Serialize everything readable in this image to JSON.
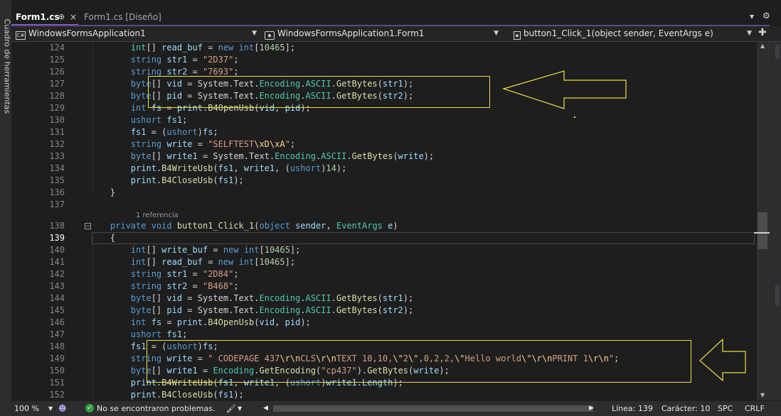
{
  "toolbox_label": "Cuadro de herramientas",
  "tabs": [
    {
      "label": "Form1.cs",
      "pin": "⊕",
      "close": "×"
    },
    {
      "label": "Form1.cs [Diseño]"
    }
  ],
  "top_icons": {
    "dropdown": "▾",
    "settings": "⚙"
  },
  "nav": {
    "project": "WindowsFormsApplication1",
    "class": "WindowsFormsApplication1.Form1",
    "member": "button1_Click_1(object sender, EventArgs e)"
  },
  "codelens_hint": "1 referencia",
  "lines": [
    {
      "n": "124",
      "tokens": [
        [
          "t",
          "        int"
        ],
        [
          "p",
          "[] "
        ],
        [
          "v",
          "read_buf"
        ],
        [
          "p",
          " = "
        ],
        [
          "k",
          "new"
        ],
        [
          "p",
          " "
        ],
        [
          "k",
          "int"
        ],
        [
          "p",
          "["
        ],
        [
          "n",
          "10465"
        ],
        [
          "p",
          "];"
        ]
      ]
    },
    {
      "n": "125",
      "tokens": [
        [
          "k",
          "        string"
        ],
        [
          "p",
          " "
        ],
        [
          "v",
          "str1"
        ],
        [
          "p",
          " = "
        ],
        [
          "s",
          "\"2D37\""
        ],
        [
          "p",
          ";"
        ]
      ]
    },
    {
      "n": "126",
      "tokens": [
        [
          "k",
          "        string"
        ],
        [
          "p",
          " "
        ],
        [
          "v",
          "str2"
        ],
        [
          "p",
          " = "
        ],
        [
          "s",
          "\"7693\""
        ],
        [
          "p",
          ";"
        ]
      ]
    },
    {
      "n": "127",
      "tokens": [
        [
          "k",
          "        byte"
        ],
        [
          "p",
          "[] "
        ],
        [
          "v",
          "vid"
        ],
        [
          "p",
          " = System.Text."
        ],
        [
          "t",
          "Encoding"
        ],
        [
          "p",
          "."
        ],
        [
          "t",
          "ASCII"
        ],
        [
          "p",
          "."
        ],
        [
          "m",
          "GetBytes"
        ],
        [
          "p",
          "("
        ],
        [
          "v",
          "str1"
        ],
        [
          "p",
          ");"
        ]
      ]
    },
    {
      "n": "128",
      "tokens": [
        [
          "k",
          "        byte"
        ],
        [
          "p",
          "[] "
        ],
        [
          "v",
          "pid"
        ],
        [
          "p",
          " = System.Text."
        ],
        [
          "t",
          "Encoding"
        ],
        [
          "p",
          "."
        ],
        [
          "t",
          "ASCII"
        ],
        [
          "p",
          "."
        ],
        [
          "m",
          "GetBytes"
        ],
        [
          "p",
          "("
        ],
        [
          "v",
          "str2"
        ],
        [
          "p",
          ");"
        ]
      ]
    },
    {
      "n": "129",
      "tokens": [
        [
          "k",
          "        int"
        ],
        [
          "p",
          " "
        ],
        [
          "v",
          "fs"
        ],
        [
          "p",
          " = "
        ],
        [
          "v",
          "print"
        ],
        [
          "p",
          "."
        ],
        [
          "m",
          "B4OpenUsb"
        ],
        [
          "p",
          "("
        ],
        [
          "v",
          "vid"
        ],
        [
          "p",
          ", "
        ],
        [
          "v",
          "pid"
        ],
        [
          "p",
          ");"
        ]
      ]
    },
    {
      "n": "130",
      "tokens": [
        [
          "k",
          "        ushort"
        ],
        [
          "p",
          " "
        ],
        [
          "v",
          "fs1"
        ],
        [
          "p",
          ";"
        ]
      ]
    },
    {
      "n": "131",
      "tokens": [
        [
          "v",
          "        fs1"
        ],
        [
          "p",
          " = ("
        ],
        [
          "k",
          "ushort"
        ],
        [
          "p",
          ")"
        ],
        [
          "v",
          "fs"
        ],
        [
          "p",
          ";"
        ]
      ]
    },
    {
      "n": "132",
      "tokens": [
        [
          "k",
          "        string"
        ],
        [
          "p",
          " "
        ],
        [
          "v",
          "write"
        ],
        [
          "p",
          " = "
        ],
        [
          "s",
          "\"SELFTEST"
        ],
        [
          "e",
          "\\xD\\xA"
        ],
        [
          "s",
          "\""
        ],
        [
          "p",
          ";"
        ]
      ]
    },
    {
      "n": "133",
      "tokens": [
        [
          "k",
          "        byte"
        ],
        [
          "p",
          "[] "
        ],
        [
          "v",
          "write1"
        ],
        [
          "p",
          " = System.Text."
        ],
        [
          "t",
          "Encoding"
        ],
        [
          "p",
          "."
        ],
        [
          "t",
          "ASCII"
        ],
        [
          "p",
          "."
        ],
        [
          "m",
          "GetBytes"
        ],
        [
          "p",
          "("
        ],
        [
          "v",
          "write"
        ],
        [
          "p",
          ");"
        ]
      ]
    },
    {
      "n": "134",
      "tokens": [
        [
          "v",
          "        print"
        ],
        [
          "p",
          "."
        ],
        [
          "m",
          "B4WriteUsb"
        ],
        [
          "p",
          "("
        ],
        [
          "v",
          "fs1"
        ],
        [
          "p",
          ", "
        ],
        [
          "v",
          "write1"
        ],
        [
          "p",
          ", ("
        ],
        [
          "k",
          "ushort"
        ],
        [
          "p",
          ")"
        ],
        [
          "n",
          "14"
        ],
        [
          "p",
          ");"
        ]
      ]
    },
    {
      "n": "135",
      "tokens": [
        [
          "v",
          "        print"
        ],
        [
          "p",
          "."
        ],
        [
          "m",
          "B4CloseUsb"
        ],
        [
          "p",
          "("
        ],
        [
          "v",
          "fs1"
        ],
        [
          "p",
          ");"
        ]
      ]
    },
    {
      "n": "136",
      "tokens": [
        [
          "p",
          "    }"
        ]
      ]
    },
    {
      "n": "137",
      "tokens": []
    },
    {
      "n": "138",
      "tokens": [
        [
          "k",
          "    private"
        ],
        [
          "p",
          " "
        ],
        [
          "k",
          "void"
        ],
        [
          "p",
          " "
        ],
        [
          "m",
          "button1_Click_1"
        ],
        [
          "p",
          "("
        ],
        [
          "k",
          "object"
        ],
        [
          "p",
          " "
        ],
        [
          "v",
          "sender"
        ],
        [
          "p",
          ", "
        ],
        [
          "t",
          "EventArgs"
        ],
        [
          "p",
          " "
        ],
        [
          "v",
          "e"
        ],
        [
          "p",
          ")"
        ]
      ]
    },
    {
      "n": "139",
      "tokens": [
        [
          "p",
          "    {"
        ]
      ]
    },
    {
      "n": "140",
      "tokens": [
        [
          "k",
          "        int"
        ],
        [
          "p",
          "[] "
        ],
        [
          "v",
          "write_buf"
        ],
        [
          "p",
          " = "
        ],
        [
          "k",
          "new"
        ],
        [
          "p",
          " "
        ],
        [
          "k",
          "int"
        ],
        [
          "p",
          "["
        ],
        [
          "n",
          "10465"
        ],
        [
          "p",
          "];"
        ]
      ]
    },
    {
      "n": "141",
      "tokens": [
        [
          "k",
          "        int"
        ],
        [
          "p",
          "[] "
        ],
        [
          "v",
          "read_buf"
        ],
        [
          "p",
          " = "
        ],
        [
          "k",
          "new"
        ],
        [
          "p",
          " "
        ],
        [
          "k",
          "int"
        ],
        [
          "p",
          "["
        ],
        [
          "n",
          "10465"
        ],
        [
          "p",
          "];"
        ]
      ]
    },
    {
      "n": "142",
      "tokens": [
        [
          "k",
          "        string"
        ],
        [
          "p",
          " "
        ],
        [
          "v",
          "str1"
        ],
        [
          "p",
          " = "
        ],
        [
          "s",
          "\"2D84\""
        ],
        [
          "p",
          ";"
        ]
      ]
    },
    {
      "n": "143",
      "tokens": [
        [
          "k",
          "        string"
        ],
        [
          "p",
          " "
        ],
        [
          "v",
          "str2"
        ],
        [
          "p",
          " = "
        ],
        [
          "s",
          "\"B468\""
        ],
        [
          "p",
          ";"
        ]
      ]
    },
    {
      "n": "144",
      "tokens": [
        [
          "k",
          "        byte"
        ],
        [
          "p",
          "[] "
        ],
        [
          "v",
          "vid"
        ],
        [
          "p",
          " = System.Text."
        ],
        [
          "t",
          "Encoding"
        ],
        [
          "p",
          "."
        ],
        [
          "t",
          "ASCII"
        ],
        [
          "p",
          "."
        ],
        [
          "m",
          "GetBytes"
        ],
        [
          "p",
          "("
        ],
        [
          "v",
          "str1"
        ],
        [
          "p",
          ");"
        ]
      ]
    },
    {
      "n": "145",
      "tokens": [
        [
          "k",
          "        byte"
        ],
        [
          "p",
          "[] "
        ],
        [
          "v",
          "pid"
        ],
        [
          "p",
          " = System.Text."
        ],
        [
          "t",
          "Encoding"
        ],
        [
          "p",
          "."
        ],
        [
          "t",
          "ASCII"
        ],
        [
          "p",
          "."
        ],
        [
          "m",
          "GetBytes"
        ],
        [
          "p",
          "("
        ],
        [
          "v",
          "str2"
        ],
        [
          "p",
          ");"
        ]
      ]
    },
    {
      "n": "146",
      "tokens": [
        [
          "k",
          "        int"
        ],
        [
          "p",
          " "
        ],
        [
          "v",
          "fs"
        ],
        [
          "p",
          " = "
        ],
        [
          "v",
          "print"
        ],
        [
          "p",
          "."
        ],
        [
          "m",
          "B4OpenUsb"
        ],
        [
          "p",
          "("
        ],
        [
          "v",
          "vid"
        ],
        [
          "p",
          ", "
        ],
        [
          "v",
          "pid"
        ],
        [
          "p",
          ");"
        ]
      ]
    },
    {
      "n": "147",
      "tokens": [
        [
          "k",
          "        ushort"
        ],
        [
          "p",
          " "
        ],
        [
          "v",
          "fs1"
        ],
        [
          "p",
          ";"
        ]
      ]
    },
    {
      "n": "148",
      "tokens": [
        [
          "v",
          "        fs1"
        ],
        [
          "p",
          " = ("
        ],
        [
          "k",
          "ushort"
        ],
        [
          "p",
          ")"
        ],
        [
          "v",
          "fs"
        ],
        [
          "p",
          ";"
        ]
      ]
    },
    {
      "n": "149",
      "tokens": [
        [
          "k",
          "        string"
        ],
        [
          "p",
          " "
        ],
        [
          "v",
          "write"
        ],
        [
          "p",
          " = "
        ],
        [
          "s",
          "\" CODEPAGE 437"
        ],
        [
          "e",
          "\\r\\n"
        ],
        [
          "s",
          "CLS"
        ],
        [
          "e",
          "\\r\\n"
        ],
        [
          "s",
          "TEXT 10,10,"
        ],
        [
          "e",
          "\\\""
        ],
        [
          "s",
          "2"
        ],
        [
          "e",
          "\\\""
        ],
        [
          "s",
          ",0,2,2,"
        ],
        [
          "e",
          "\\\""
        ],
        [
          "s",
          "Hello world"
        ],
        [
          "e",
          "\\\"\\r\\n"
        ],
        [
          "s",
          "PRINT 1"
        ],
        [
          "e",
          "\\r\\n"
        ],
        [
          "s",
          "\""
        ],
        [
          "p",
          ";"
        ]
      ]
    },
    {
      "n": "150",
      "tokens": [
        [
          "k",
          "        byte"
        ],
        [
          "p",
          "[] "
        ],
        [
          "v",
          "write1"
        ],
        [
          "p",
          " = "
        ],
        [
          "t",
          "Encoding"
        ],
        [
          "p",
          "."
        ],
        [
          "m",
          "GetEncoding"
        ],
        [
          "p",
          "("
        ],
        [
          "s",
          "\"cp437\""
        ],
        [
          "p",
          ")."
        ],
        [
          "m",
          "GetBytes"
        ],
        [
          "p",
          "("
        ],
        [
          "v",
          "write"
        ],
        [
          "p",
          ");"
        ]
      ]
    },
    {
      "n": "151",
      "tokens": [
        [
          "v",
          "        print"
        ],
        [
          "p",
          "."
        ],
        [
          "m",
          "B4WriteUsb"
        ],
        [
          "p",
          "("
        ],
        [
          "v",
          "fs1"
        ],
        [
          "p",
          ", "
        ],
        [
          "v",
          "write1"
        ],
        [
          "p",
          ", ("
        ],
        [
          "k",
          "ushort"
        ],
        [
          "p",
          ")"
        ],
        [
          "v",
          "write1"
        ],
        [
          "p",
          "."
        ],
        [
          "v",
          "Length"
        ],
        [
          "p",
          ");"
        ]
      ]
    },
    {
      "n": "152",
      "tokens": [
        [
          "v",
          "        print"
        ],
        [
          "p",
          "."
        ],
        [
          "m",
          "B4CloseUsb"
        ],
        [
          "p",
          "("
        ],
        [
          "v",
          "fs1"
        ],
        [
          "p",
          ");"
        ]
      ]
    }
  ],
  "status": {
    "zoom": "100 %",
    "problems": "No se encontraron problemas.",
    "line": "Línea: 139",
    "col": "Carácter: 10",
    "spc": "SPC",
    "crlf": "CRLF"
  },
  "colors": {
    "annotation": "#e8e040",
    "accent": "#8a6cd6"
  }
}
